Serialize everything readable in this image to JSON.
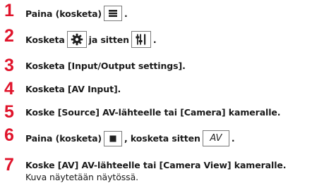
{
  "steps": [
    {
      "number": "1",
      "before": "Paina (kosketa) ",
      "after": "."
    },
    {
      "number": "2",
      "before": "Kosketa ",
      "middle": " ja sitten ",
      "after": "."
    },
    {
      "number": "3",
      "text": "Kosketa [Input/Output settings]."
    },
    {
      "number": "4",
      "text": "Kosketa [AV Input]."
    },
    {
      "number": "5",
      "text": "Koske [Source] AV-lähteelle tai [Camera] kameralle."
    },
    {
      "number": "6",
      "before": "Paina (kosketa) ",
      "middle": ", kosketa sitten ",
      "after": ".",
      "av_label": "AV"
    },
    {
      "number": "7",
      "text": "Koske [AV] AV-lähteelle tai [Camera View] kameralle.",
      "subtext": "Kuva näytetään näytössä."
    }
  ],
  "icons": {
    "step1": "menu-icon",
    "step2_a": "gear-icon",
    "step2_b": "settings-sliders-icon",
    "step6_a": "square-stop-icon",
    "step6_b": "av-icon"
  },
  "colors": {
    "step_number": "#e0142b",
    "text": "#1a1a1a",
    "icon_border": "#7a7a7a"
  }
}
